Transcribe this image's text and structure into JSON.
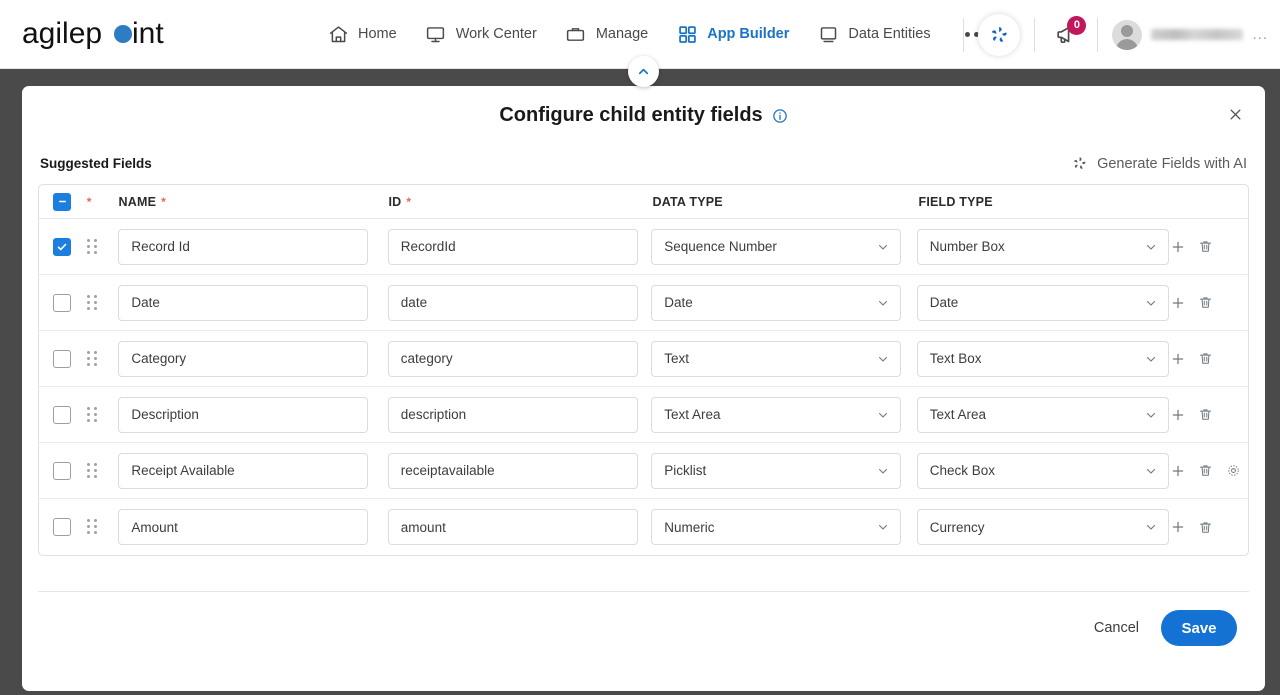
{
  "nav": {
    "brand": "agilepoint",
    "items": [
      {
        "label": "Home",
        "icon": "home-icon",
        "active": false
      },
      {
        "label": "Work Center",
        "icon": "monitor-icon",
        "active": false
      },
      {
        "label": "Manage",
        "icon": "briefcase-icon",
        "active": false
      },
      {
        "label": "App Builder",
        "icon": "grid-icon",
        "active": true
      },
      {
        "label": "Data Entities",
        "icon": "screen-icon",
        "active": false
      }
    ],
    "more_label": "more-options",
    "ai_assistant_icon": "ai-pinwheel-icon",
    "notifications": {
      "icon": "megaphone-icon",
      "count": "0"
    },
    "user": {
      "avatar_icon": "avatar-icon",
      "name": "",
      "overflow": "..."
    }
  },
  "collapse_button": {
    "icon": "chevron-up-icon"
  },
  "dialog": {
    "title": "Configure child entity fields",
    "info_icon": "info-icon",
    "close_icon": "close-icon",
    "suggested_label": "Suggested Fields",
    "generate_ai": {
      "label": "Generate Fields with AI",
      "icon": "ai-pinwheel-icon"
    },
    "table": {
      "select_all_state": "indeterminate",
      "headers": {
        "select": "",
        "name": "NAME",
        "id": "ID",
        "data_type": "DATA TYPE",
        "field_type": "FIELD TYPE"
      },
      "required_marker": "*",
      "rows": [
        {
          "checked": true,
          "name": "Record Id",
          "id": "RecordId",
          "data_type": "Sequence Number",
          "field_type": "Number Box",
          "has_settings": false
        },
        {
          "checked": false,
          "name": "Date",
          "id": "date",
          "data_type": "Date",
          "field_type": "Date",
          "has_settings": false
        },
        {
          "checked": false,
          "name": "Category",
          "id": "category",
          "data_type": "Text",
          "field_type": "Text Box",
          "has_settings": false
        },
        {
          "checked": false,
          "name": "Description",
          "id": "description",
          "data_type": "Text Area",
          "field_type": "Text Area",
          "has_settings": false
        },
        {
          "checked": false,
          "name": "Receipt Available",
          "id": "receiptavailable",
          "data_type": "Picklist",
          "field_type": "Check Box",
          "has_settings": true
        },
        {
          "checked": false,
          "name": "Amount",
          "id": "amount",
          "data_type": "Numeric",
          "field_type": "Currency",
          "has_settings": false
        }
      ],
      "row_actions": {
        "add_icon": "plus-icon",
        "delete_icon": "trash-icon",
        "settings_icon": "gear-icon"
      }
    },
    "footer": {
      "cancel_label": "Cancel",
      "save_label": "Save"
    }
  },
  "colors": {
    "accent": "#1372d4",
    "active_nav": "#1a73c8",
    "badge": "#c2185b",
    "required": "#e06c5a",
    "overlay": "#4a4a4a"
  }
}
